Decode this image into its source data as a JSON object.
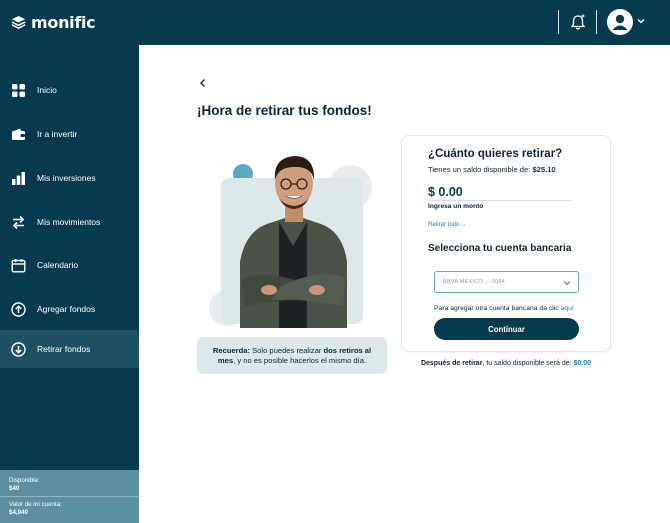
{
  "app": {
    "brand": "monific"
  },
  "colors": {
    "primary": "#063a4e",
    "sidebar_active": "#1f4f62",
    "balance_panel": "#5d8fa3",
    "accent_link": "#1b7fa8",
    "notice_bg": "#dde8ea"
  },
  "header": {
    "notifications_icon": "bell-icon",
    "profile_icon": "user-avatar-icon",
    "dropdown_icon": "chevron-down-icon"
  },
  "sidebar": {
    "items": [
      {
        "label": "Inicio",
        "icon": "grid-icon"
      },
      {
        "label": "Ir a invertir",
        "icon": "wallet-icon"
      },
      {
        "label": "Mis inversiones",
        "icon": "bar-chart-icon"
      },
      {
        "label": "Mis movimientos",
        "icon": "swap-arrows-icon"
      },
      {
        "label": "Calendario",
        "icon": "calendar-icon"
      },
      {
        "label": "Agregar fondos",
        "icon": "arrow-up-circle-icon"
      },
      {
        "label": "Retirar fondos",
        "icon": "arrow-down-circle-icon",
        "active": true
      }
    ],
    "balance": {
      "available_label": "Disponible:",
      "available_value": "$40",
      "account_label": "Valor de mi cuenta:",
      "account_value": "$4,040"
    }
  },
  "main": {
    "title": "¡Hora de retirar tus fondos!",
    "notice": {
      "prefix": "Recuerda:",
      "text1": " Solo puedes realizar ",
      "highlight": "dos retiros al mes",
      "text2": ", y no es posible hacerlos el mismo día."
    },
    "withdraw_card": {
      "title": "¿Cuánto quieres retirar?",
      "available_text": "Tienes un saldo disponible de: ",
      "available_amount": "$25.10",
      "amount_value": "$ 0.00",
      "amount_label": "Ingresa un monto",
      "withdraw_all": "Retirar todo →",
      "bank_title": "Selecciona tu cuenta bancaria",
      "bank_selected": "BBVA MEXICO ....0094",
      "add_account_text": "Para agregar otra cuenta bancaria da clic ",
      "add_account_link": "aquí",
      "continue_label": "Continuar"
    },
    "after_withdraw": {
      "bold": "Después de retirar",
      "text": ", tu saldo disponible será de: ",
      "amount": "$0.00"
    }
  }
}
